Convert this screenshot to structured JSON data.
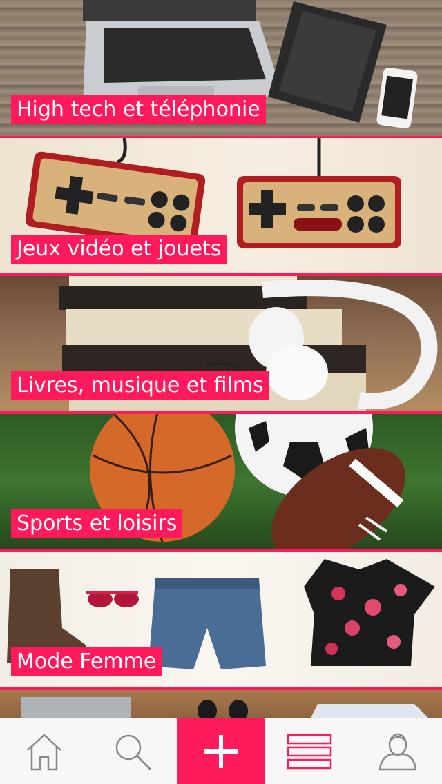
{
  "categories": [
    {
      "label": "High tech et téléphonie"
    },
    {
      "label": "Jeux vidéo et jouets"
    },
    {
      "label": "Livres, musique et films"
    },
    {
      "label": "Sports et loisirs"
    },
    {
      "label": "Mode Femme"
    }
  ],
  "tabbar": {
    "tabs": [
      {
        "icon": "home-icon"
      },
      {
        "icon": "search-icon"
      },
      {
        "icon": "plus-icon"
      },
      {
        "icon": "menu-list-icon"
      },
      {
        "icon": "user-icon"
      }
    ]
  },
  "colors": {
    "accent": "#ff1a5c",
    "tabbar_bg": "#f7f7f7",
    "icon_gray": "#888888"
  }
}
